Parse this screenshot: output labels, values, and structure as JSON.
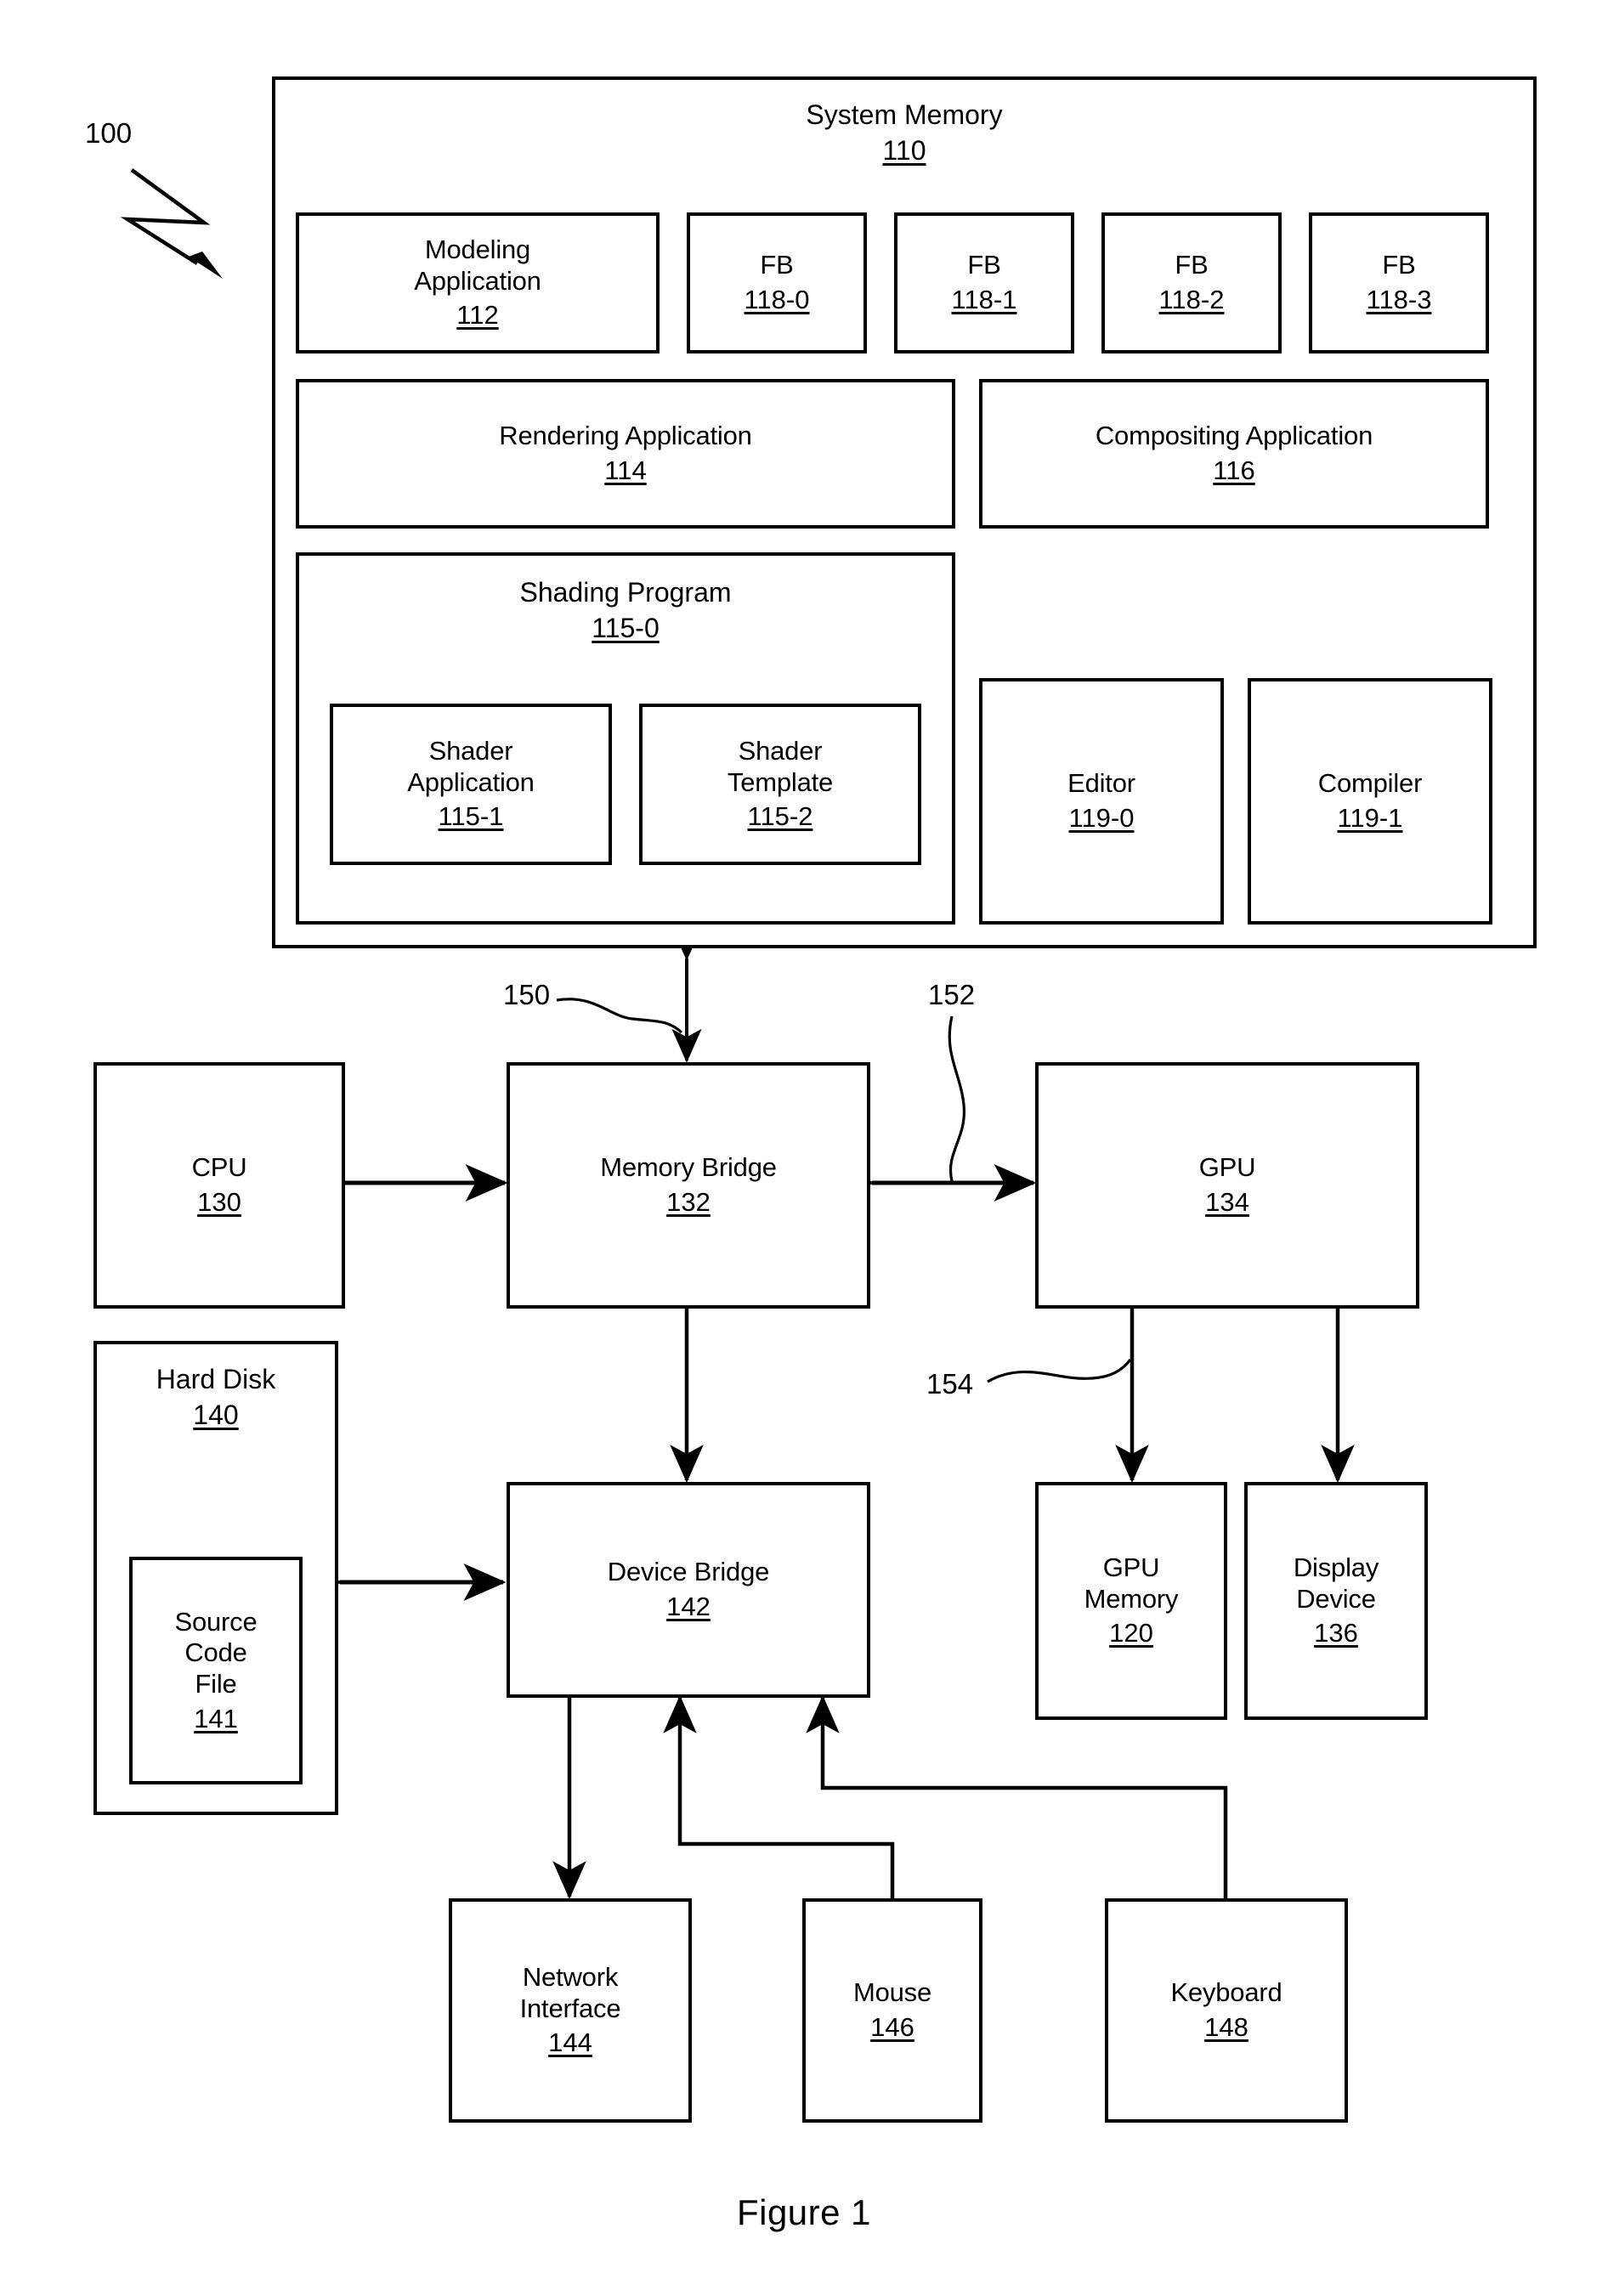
{
  "figure": {
    "caption": "Figure 1",
    "system_ref": "100"
  },
  "system_memory": {
    "title": "System Memory",
    "number": "110",
    "modeling_application": {
      "label": "Modeling\nApplication",
      "number": "112"
    },
    "frame_buffers": [
      {
        "label": "FB",
        "number": "118-0"
      },
      {
        "label": "FB",
        "number": "118-1"
      },
      {
        "label": "FB",
        "number": "118-2"
      },
      {
        "label": "FB",
        "number": "118-3"
      }
    ],
    "rendering_application": {
      "label": "Rendering Application",
      "number": "114"
    },
    "compositing_application": {
      "label": "Compositing Application",
      "number": "116"
    },
    "shading_program": {
      "title": "Shading Program",
      "number": "115-0",
      "shader_application": {
        "label": "Shader\nApplication",
        "number": "115-1"
      },
      "shader_template": {
        "label": "Shader\nTemplate",
        "number": "115-2"
      }
    },
    "editor": {
      "label": "Editor",
      "number": "119-0"
    },
    "compiler": {
      "label": "Compiler",
      "number": "119-1"
    }
  },
  "hardware": {
    "cpu": {
      "label": "CPU",
      "number": "130"
    },
    "memory_bridge": {
      "label": "Memory Bridge",
      "number": "132"
    },
    "gpu": {
      "label": "GPU",
      "number": "134"
    },
    "hard_disk": {
      "label": "Hard Disk",
      "number": "140"
    },
    "source_code_file": {
      "label": "Source\nCode\nFile",
      "number": "141"
    },
    "device_bridge": {
      "label": "Device Bridge",
      "number": "142"
    },
    "gpu_memory": {
      "label": "GPU\nMemory",
      "number": "120"
    },
    "display_device": {
      "label": "Display\nDevice",
      "number": "136"
    },
    "network_interface": {
      "label": "Network\nInterface",
      "number": "144"
    },
    "mouse": {
      "label": "Mouse",
      "number": "146"
    },
    "keyboard": {
      "label": "Keyboard",
      "number": "148"
    }
  },
  "bus_refs": {
    "memory_bus": "150",
    "gpu_bus": "152",
    "gpu_memory_bus": "154"
  }
}
